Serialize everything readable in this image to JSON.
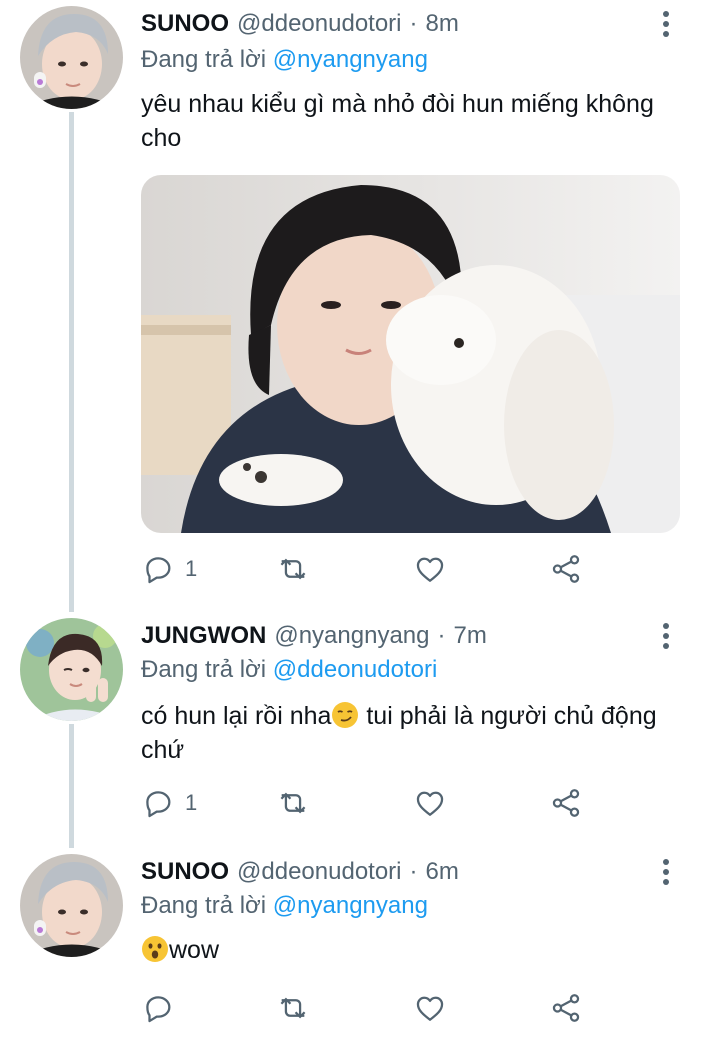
{
  "tweets": [
    {
      "name": "SUNOO",
      "handle": "@ddeonudotori",
      "separator": "·",
      "time": "8m",
      "reply_prefix": "Đang trả lời",
      "reply_to": "@nyangnyang",
      "text": "yêu nhau kiểu gì mà nhỏ đòi hun miếng không cho",
      "reply_count": "1",
      "has_media": true
    },
    {
      "name": "JUNGWON",
      "handle": "@nyangnyang",
      "separator": "·",
      "time": "7m",
      "reply_prefix": "Đang trả lời",
      "reply_to": "@ddeonudotori",
      "text_before_emoji": "có hun lại rồi nha",
      "emoji": "smirking-face",
      "text_after_emoji": " tui phải là người chủ động chứ",
      "reply_count": "1"
    },
    {
      "name": "SUNOO",
      "handle": "@ddeonudotori",
      "separator": "·",
      "time": "6m",
      "reply_prefix": "Đang trả lời",
      "reply_to": "@nyangnyang",
      "emoji": "astonished-face",
      "text": "wow",
      "reply_count": ""
    }
  ],
  "icons": {
    "reply": "reply-icon",
    "retweet": "retweet-icon",
    "like": "heart-icon",
    "share": "share-icon",
    "menu": "more-vertical-icon"
  },
  "colors": {
    "text_primary": "#0f1419",
    "text_secondary": "#536471",
    "mention": "#1d9bf0",
    "thread_line": "#cfd9de",
    "emoji_yellow": "#f7c434"
  }
}
